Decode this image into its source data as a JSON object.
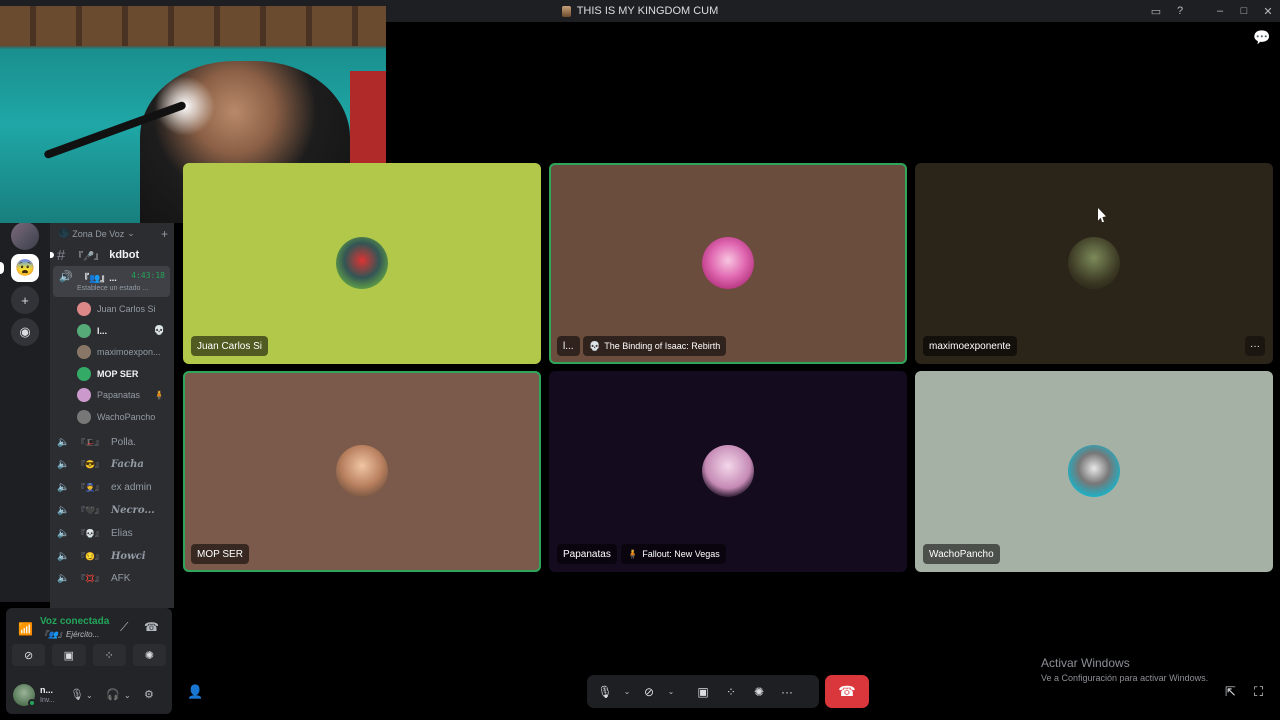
{
  "window": {
    "title": "THIS IS MY KINGDOM CUM",
    "controls": [
      "inbox-icon",
      "help-icon",
      "minimize",
      "maximize",
      "close"
    ]
  },
  "sidebar": {
    "category": "Zona De Voz",
    "text_channel": {
      "prefix": "『🎤』",
      "name": "kdbot"
    },
    "active_voice": {
      "label": "『👥』...",
      "timer": "4:43:18",
      "status": "Establece un estado ..."
    },
    "members": [
      {
        "name": "Juan Carlos Si",
        "bright": false
      },
      {
        "name": "l...",
        "bright": true,
        "tag": "💀"
      },
      {
        "name": "maximoexpon...",
        "bright": false
      },
      {
        "name": "MOP SER",
        "bright": true
      },
      {
        "name": "Papanatas",
        "bright": false,
        "tag": "🧍"
      },
      {
        "name": "WachoPancho",
        "bright": false
      }
    ],
    "voice_channels": [
      {
        "prefix": "『🎩』",
        "name": "Polla.",
        "style": "plain"
      },
      {
        "prefix": "『😎』",
        "name": "Facha",
        "style": "fancy"
      },
      {
        "prefix": "『👮』",
        "name": "ex admin",
        "style": "plain"
      },
      {
        "prefix": "『🖤』",
        "name": "Necro...",
        "style": "fancy"
      },
      {
        "prefix": "『💀』",
        "name": "Elias",
        "style": "plain"
      },
      {
        "prefix": "『😏』",
        "name": "Howci",
        "style": "fancy"
      },
      {
        "prefix": "『💢』",
        "name": "AFK",
        "style": "plain"
      }
    ],
    "voice_status": {
      "title": "Voz conectada",
      "channel": "『👥』Ejército..."
    },
    "user": {
      "name": "n...",
      "status": "Inv..."
    }
  },
  "tiles": [
    {
      "name": "Juan Carlos Si",
      "bg": "#b2c84a",
      "speaking": false,
      "activity": ""
    },
    {
      "name": "l...",
      "bg": "#6b4d3e",
      "speaking": true,
      "activity": "The Binding of Isaac: Rebirth"
    },
    {
      "name": "maximoexponente",
      "bg": "#2a2419",
      "speaking": false,
      "activity": ""
    },
    {
      "name": "MOP SER",
      "bg": "#7b5a4b",
      "speaking": true,
      "activity": ""
    },
    {
      "name": "Papanatas",
      "bg": "#150b1f",
      "speaking": false,
      "activity": "Fallout: New Vegas"
    },
    {
      "name": "WachoPancho",
      "bg": "#a6b1a6",
      "speaking": false,
      "activity": ""
    }
  ],
  "windows_notice": {
    "line1": "Activar Windows",
    "line2": "Ve a Configuración para activar Windows."
  }
}
